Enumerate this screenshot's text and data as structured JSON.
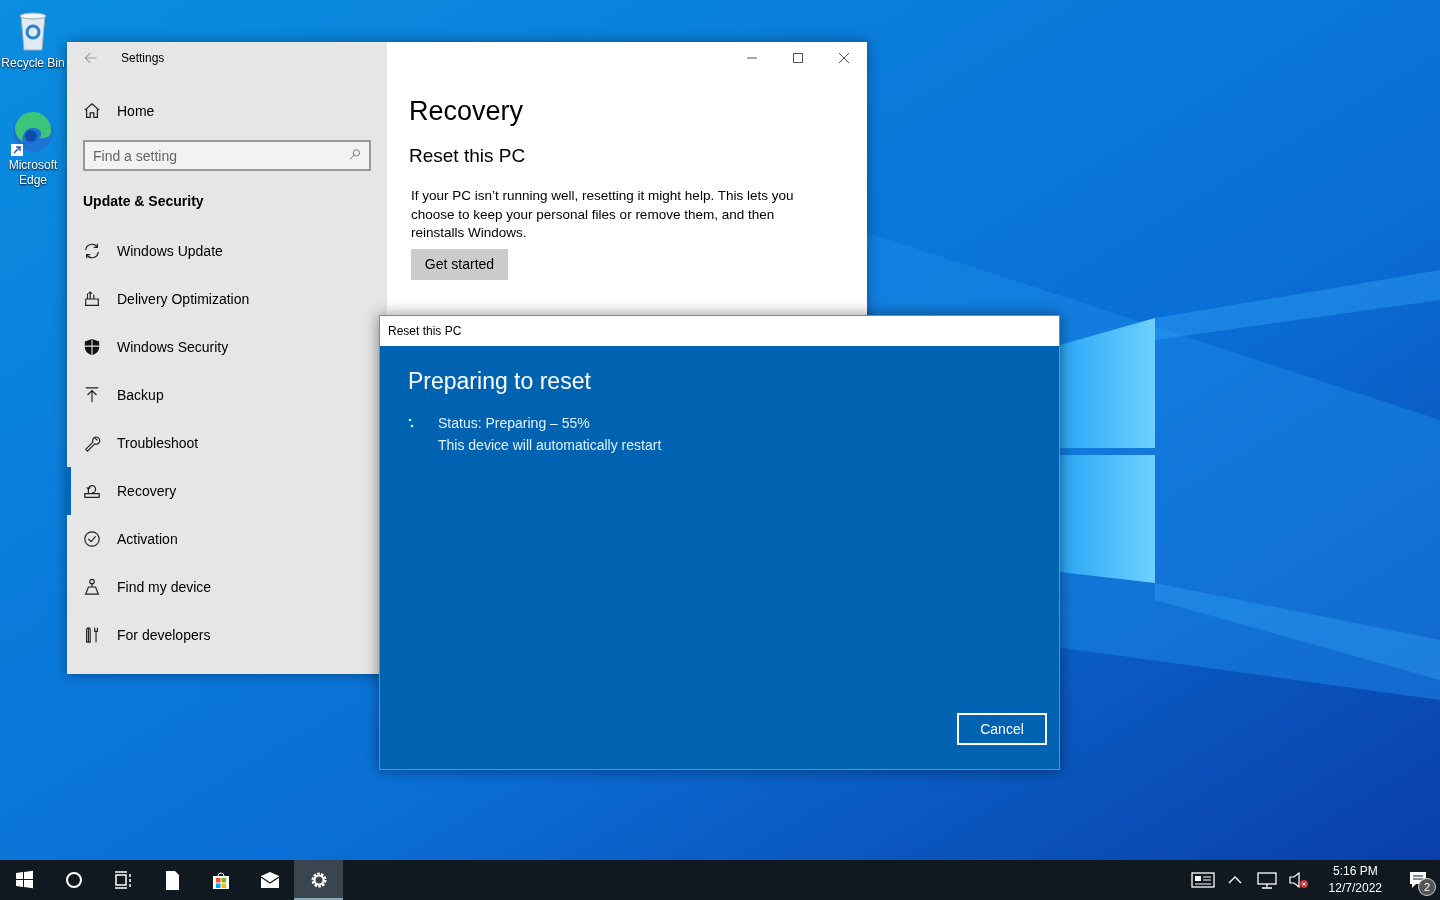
{
  "desktop_icons": [
    {
      "kind": "recycle",
      "label": "Recycle Bin"
    },
    {
      "kind": "edge",
      "label": "Microsoft Edge"
    }
  ],
  "settings": {
    "title": "Settings",
    "home": "Home",
    "search": {
      "placeholder": "Find a setting"
    },
    "section": "Update & Security",
    "nav": [
      {
        "kind": "update",
        "label": "Windows Update",
        "selected": false
      },
      {
        "kind": "delivery",
        "label": "Delivery Optimization",
        "selected": false
      },
      {
        "kind": "security",
        "label": "Windows Security",
        "selected": false
      },
      {
        "kind": "backup",
        "label": "Backup",
        "selected": false
      },
      {
        "kind": "troubleshoot",
        "label": "Troubleshoot",
        "selected": false
      },
      {
        "kind": "recovery",
        "label": "Recovery",
        "selected": true
      },
      {
        "kind": "activation",
        "label": "Activation",
        "selected": false
      },
      {
        "kind": "find",
        "label": "Find my device",
        "selected": false
      },
      {
        "kind": "developers",
        "label": "For developers",
        "selected": false
      }
    ],
    "heading": "Recovery",
    "subheading": "Reset this PC",
    "description": "If your PC isn’t running well, resetting it might help. This lets you choose to keep your personal files or remove them, and then reinstalls Windows.",
    "button": "Get started"
  },
  "dialog": {
    "title": "Reset this PC",
    "heading": "Preparing to reset",
    "status": "Status: Preparing – 55%",
    "note": "This device will automatically restart",
    "button": "Cancel"
  },
  "taskbar": {
    "apps": [
      {
        "kind": "start",
        "selected": false
      },
      {
        "kind": "search",
        "selected": false
      },
      {
        "kind": "taskview",
        "selected": false
      },
      {
        "kind": "file",
        "selected": false
      },
      {
        "kind": "store",
        "selected": false
      },
      {
        "kind": "mail",
        "selected": false
      },
      {
        "kind": "settings",
        "selected": true
      }
    ],
    "time": "5:16 PM",
    "date": "12/7/2022",
    "notifications": "2"
  }
}
